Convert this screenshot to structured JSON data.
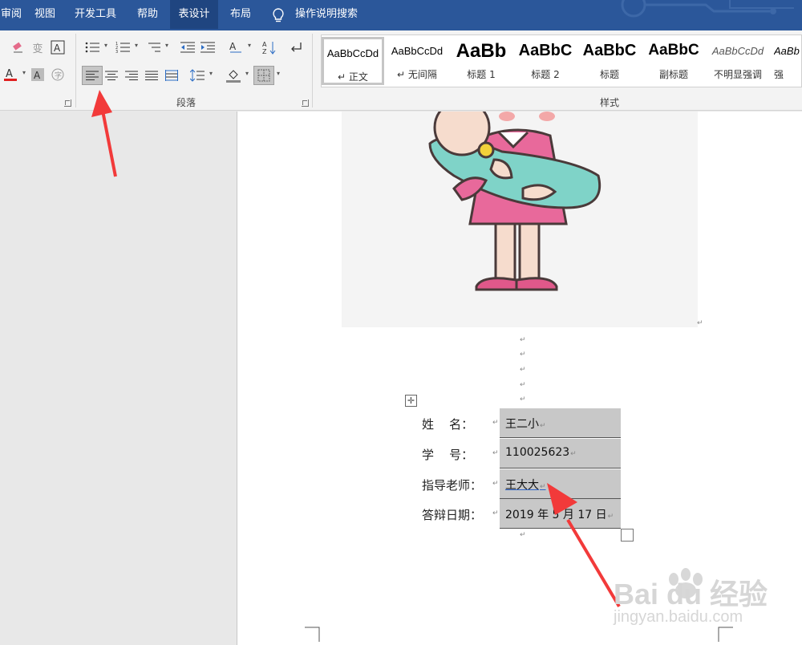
{
  "menu": {
    "items": [
      {
        "label": "审阅",
        "active": false
      },
      {
        "label": "视图",
        "active": false
      },
      {
        "label": "开发工具",
        "active": false
      },
      {
        "label": "帮助",
        "active": false
      },
      {
        "label": "表设计",
        "active": true
      },
      {
        "label": "布局",
        "active": false
      }
    ],
    "search_label": "操作说明搜索"
  },
  "ribbon": {
    "paragraph_group_label": "段落",
    "styles_group_label": "样式",
    "styles": [
      {
        "preview": "AaBbCcDd",
        "name": "正文",
        "selected": true
      },
      {
        "preview": "AaBbCcDd",
        "name": "无间隔",
        "selected": false
      },
      {
        "preview": "AaBb",
        "name": "标题 1",
        "selected": false
      },
      {
        "preview": "AaBbC",
        "name": "标题 2",
        "selected": false
      },
      {
        "preview": "AaBbC",
        "name": "标题",
        "selected": false
      },
      {
        "preview": "AaBbC",
        "name": "副标题",
        "selected": false
      },
      {
        "preview": "AaBbCcDd",
        "name": "不明显强调",
        "selected": false
      },
      {
        "preview": "AaBb",
        "name": "强",
        "selected": false
      }
    ]
  },
  "document": {
    "table": [
      {
        "label": "姓    名：",
        "value": "王二小"
      },
      {
        "label": "学    号：",
        "value": "110025623"
      },
      {
        "label": "指导老师：",
        "value": "王大大"
      },
      {
        "label": "答辩日期：",
        "value": "2019 年 5 月 17 日"
      }
    ]
  },
  "watermark": {
    "brand": "Bai du 经验",
    "url": "jingyan.baidu.com"
  },
  "colors": {
    "menu_bar": "#2b579a",
    "menu_active": "#1f4580",
    "ribbon_bg": "#f3f3f3",
    "cell_fill": "#c8c8c8",
    "arrow": "#f23a3a"
  }
}
